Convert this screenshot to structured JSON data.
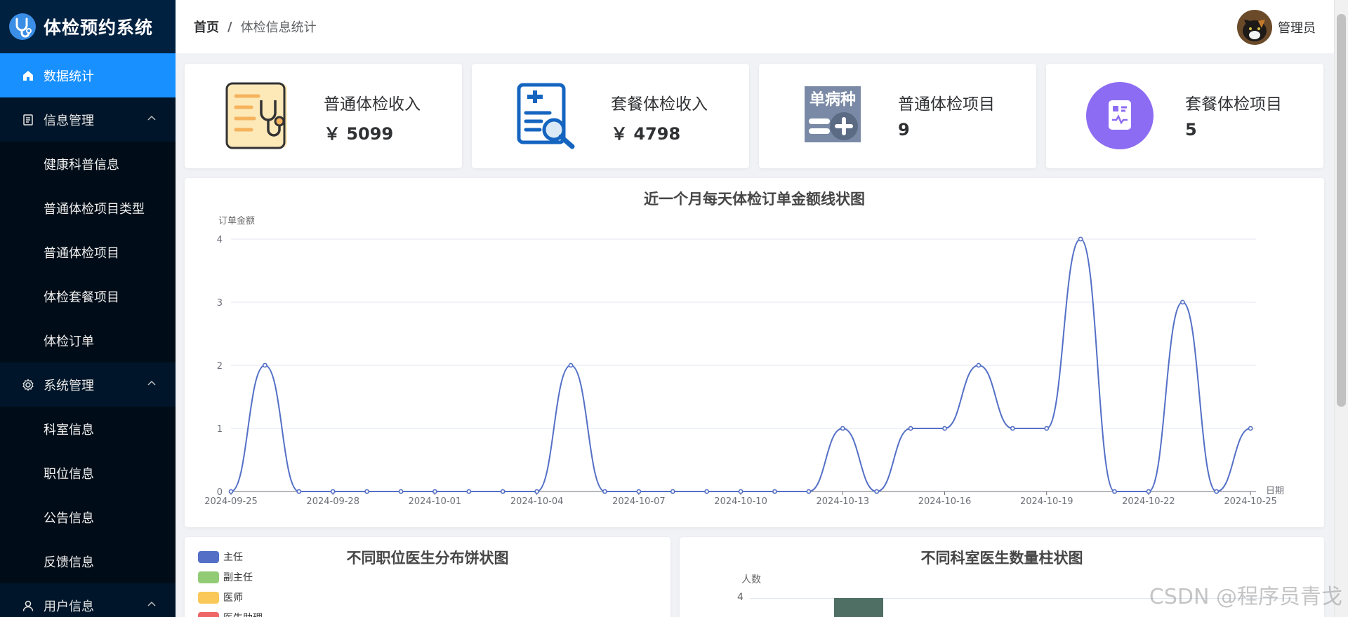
{
  "app": {
    "title": "体检预约系统"
  },
  "sidebar": {
    "active": {
      "label": "数据统计",
      "icon": "home-icon"
    },
    "groups": [
      {
        "label": "信息管理",
        "icon": "document-icon",
        "items": [
          "健康科普信息",
          "普通体检项目类型",
          "普通体检项目",
          "体检套餐项目",
          "体检订单"
        ]
      },
      {
        "label": "系统管理",
        "icon": "gear-icon",
        "items": [
          "科室信息",
          "职位信息",
          "公告信息",
          "反馈信息"
        ]
      },
      {
        "label": "用户信息",
        "icon": "user-icon",
        "items": []
      }
    ]
  },
  "header": {
    "breadcrumb": {
      "home": "首页",
      "separator": "/",
      "current": "体检信息统计"
    },
    "user_name": "管理员"
  },
  "cards": [
    {
      "label": "普通体检收入",
      "value": "￥ 5099",
      "icon": "stethoscope-icon"
    },
    {
      "label": "套餐体检收入",
      "value": "￥ 4798",
      "icon": "medical-report-search-icon"
    },
    {
      "label": "普通体检项目",
      "value": "9",
      "icon": "single-disease-add-icon",
      "icon_text": "单病种"
    },
    {
      "label": "套餐体检项目",
      "value": "5",
      "icon": "health-record-icon"
    }
  ],
  "line_chart": {
    "chart_data": {
      "type": "line",
      "title": "近一个月每天体检订单金额线状图",
      "xlabel": "日期",
      "ylabel": "订单金额",
      "ylim": [
        0,
        4
      ],
      "yticks": [
        0,
        1,
        2,
        3,
        4
      ],
      "x": [
        "2024-09-25",
        "2024-09-26",
        "2024-09-27",
        "2024-09-28",
        "2024-09-29",
        "2024-09-30",
        "2024-10-01",
        "2024-10-02",
        "2024-10-03",
        "2024-10-04",
        "2024-10-05",
        "2024-10-06",
        "2024-10-07",
        "2024-10-08",
        "2024-10-09",
        "2024-10-10",
        "2024-10-11",
        "2024-10-12",
        "2024-10-13",
        "2024-10-14",
        "2024-10-15",
        "2024-10-16",
        "2024-10-17",
        "2024-10-18",
        "2024-10-19",
        "2024-10-20",
        "2024-10-21",
        "2024-10-22",
        "2024-10-23",
        "2024-10-24",
        "2024-10-25"
      ],
      "x_tick_labels": [
        "2024-09-25",
        "2024-09-28",
        "2024-10-01",
        "2024-10-04",
        "2024-10-07",
        "2024-10-10",
        "2024-10-13",
        "2024-10-16",
        "2024-10-19",
        "2024-10-22",
        "2024-10-25"
      ],
      "values": [
        0,
        2,
        0,
        0,
        0,
        0,
        0,
        0,
        0,
        0,
        2,
        0,
        0,
        0,
        0,
        0,
        0,
        0,
        1,
        0,
        1,
        1,
        2,
        1,
        1,
        4,
        0,
        0,
        3,
        0,
        1
      ],
      "color": "#5470c6",
      "grid": true
    }
  },
  "pie_chart": {
    "chart_data": {
      "type": "pie",
      "title": "不同职位医生分布饼状图",
      "legend": [
        {
          "name": "主任",
          "color": "#5470c6"
        },
        {
          "name": "副主任",
          "color": "#91cc75"
        },
        {
          "name": "医师",
          "color": "#fac858"
        },
        {
          "name": "医生助理",
          "color": "#ee6666"
        }
      ],
      "legend_position": "top-left"
    }
  },
  "bar_chart": {
    "chart_data": {
      "type": "bar",
      "title": "不同科室医生数量柱状图",
      "ylabel": "人数",
      "yticks_visible": [
        4
      ],
      "bar_color": "#4f6e64"
    }
  },
  "watermark": "CSDN @程序员青戈"
}
